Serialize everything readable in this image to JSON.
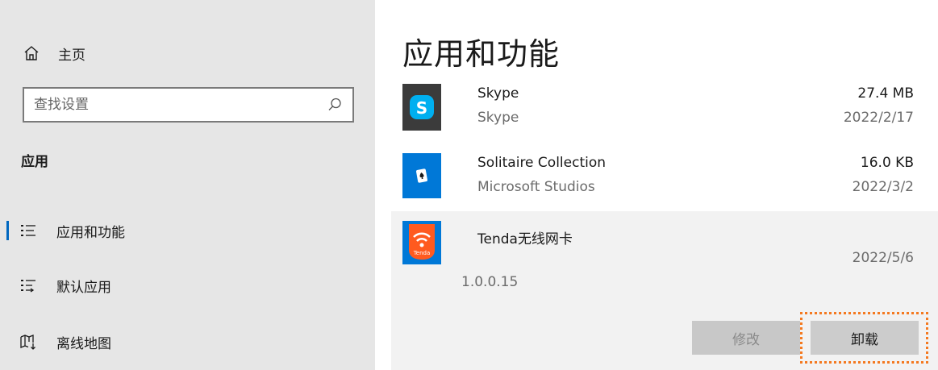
{
  "sidebar": {
    "home_label": "主页",
    "search_placeholder": "查找设置",
    "section_title": "应用",
    "items": [
      {
        "label": "应用和功能",
        "icon": "apps-features-icon",
        "active": true
      },
      {
        "label": "默认应用",
        "icon": "default-apps-icon",
        "active": false
      },
      {
        "label": "离线地图",
        "icon": "offline-maps-icon",
        "active": false
      }
    ]
  },
  "main": {
    "title": "应用和功能",
    "apps": [
      {
        "name": "Skype",
        "publisher": "Skype",
        "size": "27.4 MB",
        "date": "2022/2/17"
      },
      {
        "name": "Solitaire Collection",
        "publisher": "Microsoft Studios",
        "size": "16.0 KB",
        "date": "2022/3/2"
      },
      {
        "name": "Tenda无线网卡",
        "icon_text": "Tenda",
        "date": "2022/5/6",
        "version": "1.0.0.15",
        "selected": true
      }
    ],
    "buttons": {
      "modify": "修改",
      "uninstall": "卸载"
    }
  },
  "colors": {
    "accent": "#0067c0",
    "highlight": "#f47920",
    "skype_bg": "#3b3b3b",
    "skype_badge": "#00aff0",
    "solitaire_bg": "#0078d7",
    "tenda_bg": "#0078d7",
    "tenda_logo": "#ff5a1f"
  }
}
